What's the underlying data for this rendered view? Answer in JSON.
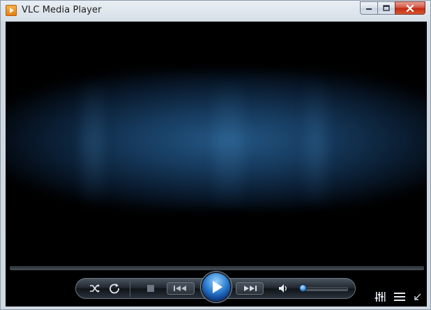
{
  "window": {
    "title": "VLC Media Player",
    "app_icon": "vlc-cone-icon"
  },
  "caption_buttons": {
    "minimize_icon": "minimize-icon",
    "maximize_icon": "maximize-icon",
    "close_icon": "close-icon"
  },
  "video": {
    "state": "idle-visualization"
  },
  "seek": {
    "position": 0
  },
  "controls": {
    "shuffle_icon": "shuffle-icon",
    "repeat_icon": "repeat-icon",
    "stop_icon": "stop-icon",
    "previous_icon": "skip-previous-icon",
    "play_icon": "play-icon",
    "next_icon": "skip-next-icon",
    "volume_icon": "speaker-icon",
    "volume_level": 0.05,
    "equalizer_icon": "equalizer-icon",
    "playlist_icon": "playlist-icon",
    "fullscreen_icon": "resize-icon"
  },
  "colors": {
    "accent": "#2e7fd0",
    "video_glow": "#265c8c",
    "close_button": "#c7422a"
  }
}
